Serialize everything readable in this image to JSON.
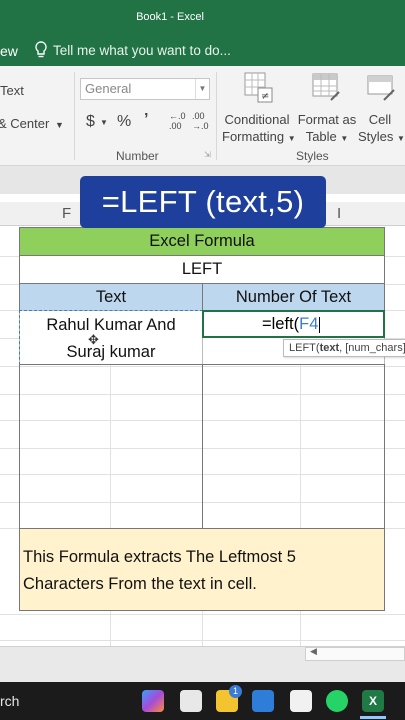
{
  "window": {
    "title": "Book1 - Excel"
  },
  "tellbar": {
    "view_tab": "ew",
    "tell_me": "Tell me what you want to do..."
  },
  "ribbon": {
    "wrap_text": "Text",
    "merge_center": "& Center",
    "number_format": "General",
    "currency": "$",
    "percent": "%",
    "comma": "ņ",
    "inc_decimal": "←.0 .00",
    "dec_decimal": ".00 →.0",
    "number_group": "Number",
    "conditional_formatting": [
      "Conditional",
      "Formatting"
    ],
    "format_as_table": [
      "Format as",
      "Table"
    ],
    "cell_styles": [
      "Cell",
      "Styles"
    ],
    "styles_group": "Styles"
  },
  "columns": {
    "f": "F",
    "i": "I"
  },
  "caption": "=LEFT (text,5)",
  "table": {
    "title": "Excel Formula",
    "subtitle": "LEFT",
    "header_text": "Text",
    "header_number": "Number Of Text",
    "text_line1": "Rahul Kumar And",
    "text_line2": "Suraj kumar",
    "formula_prefix": "=left(",
    "formula_ref": "F4",
    "tooltip_func": "LEFT(",
    "tooltip_arg1": "text",
    "tooltip_rest": ", [num_chars])",
    "note_line1": "This Formula extracts The Leftmost 5",
    "note_line2": "Characters From the text in cell."
  },
  "taskbar": {
    "search": "rch"
  },
  "colors": {
    "excel_green": "#217346",
    "header_green": "#8fcf5b",
    "header_blue": "#bdd7ee",
    "note_yellow": "#fff2cc",
    "caption_blue": "#1f3f9c"
  }
}
